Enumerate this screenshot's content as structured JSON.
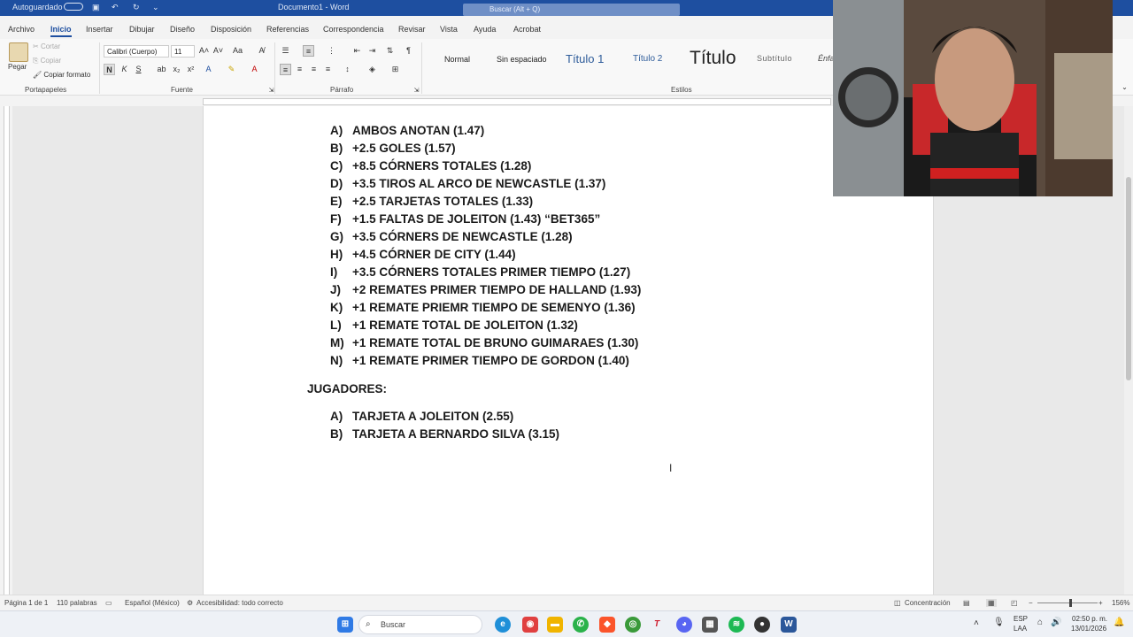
{
  "title_bar": {
    "autosave": "Autoguardado",
    "doc_title": "Documento1 - Word",
    "search_placeholder": "Buscar (Alt + Q)"
  },
  "menu_tabs": [
    "Archivo",
    "Inicio",
    "Insertar",
    "Dibujar",
    "Diseño",
    "Disposición",
    "Referencias",
    "Correspondencia",
    "Revisar",
    "Vista",
    "Ayuda",
    "Acrobat"
  ],
  "active_tab": "Inicio",
  "clipboard": {
    "paste": "Pegar",
    "cut": "Cortar",
    "copy": "Copiar",
    "format_painter": "Copiar formato",
    "label": "Portapapeles"
  },
  "font": {
    "name": "Calibri (Cuerpo)",
    "size": "11",
    "label": "Fuente",
    "bold": "N",
    "italic": "K",
    "underline": "S"
  },
  "paragraph": {
    "label": "Párrafo"
  },
  "styles": {
    "items": [
      "Normal",
      "Sin espaciado",
      "Título 1",
      "Título 2",
      "Título",
      "Subtítulo",
      "Énfa"
    ],
    "label": "Estilos"
  },
  "document": {
    "list1": [
      {
        "marker": "A)",
        "text": "AMBOS ANOTAN (1.47)"
      },
      {
        "marker": "B)",
        "text": "+2.5 GOLES (1.57)"
      },
      {
        "marker": "C)",
        "text": "+8.5 CÓRNERS TOTALES (1.28)"
      },
      {
        "marker": "D)",
        "text": "+3.5 TIROS AL ARCO DE NEWCASTLE (1.37)"
      },
      {
        "marker": "E)",
        "text": "+2.5 TARJETAS TOTALES (1.33)"
      },
      {
        "marker": "F)",
        "text": "+1.5 FALTAS DE JOLEITON (1.43) “BET365”"
      },
      {
        "marker": "G)",
        "text": "+3.5 CÓRNERS DE NEWCASTLE (1.28)"
      },
      {
        "marker": "H)",
        "text": "+4.5 CÓRNER DE CITY (1.44)"
      },
      {
        "marker": "I)",
        "text": "+3.5 CÓRNERS TOTALES PRIMER TIEMPO (1.27)"
      },
      {
        "marker": "J)",
        "text": "+2 REMATES PRIMER TIEMPO DE HALLAND (1.93)"
      },
      {
        "marker": "K)",
        "text": "+1 REMATE PRIEMR TIEMPO DE SEMENYO (1.36)"
      },
      {
        "marker": "L)",
        "text": "+1 REMATE TOTAL DE JOLEITON (1.32)"
      },
      {
        "marker": "M)",
        "text": "+1 REMATE TOTAL DE BRUNO GUIMARAES (1.30)"
      },
      {
        "marker": "N)",
        "text": "+1 REMATE PRIMER TIEMPO DE GORDON (1.40)"
      }
    ],
    "heading": "JUGADORES:",
    "list2": [
      {
        "marker": "A)",
        "text": "TARJETA A JOLEITON (2.55)"
      },
      {
        "marker": "B)",
        "text": "TARJETA A BERNARDO SILVA (3.15)"
      }
    ]
  },
  "status_bar": {
    "page": "Página 1 de 1",
    "words": "110 palabras",
    "language": "Español (México)",
    "accessibility": "Accesibilidad: todo correcto",
    "focus": "Concentración",
    "zoom": "156%"
  },
  "taskbar": {
    "search": "Buscar",
    "lang1": "ESP",
    "lang2": "LAA",
    "time": "02:50 p. m.",
    "date": "13/01/2026"
  },
  "colors": {
    "word_blue": "#1e4fa0",
    "page_bg": "#ffffff",
    "text": "#1a1a1a"
  }
}
